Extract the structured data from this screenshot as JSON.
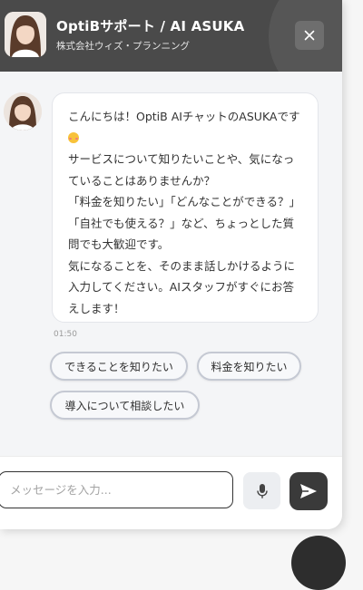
{
  "header": {
    "title": "OptiBサポート / AI ASUKA",
    "subtitle": "株式会社ウィズ・プランニング"
  },
  "message": {
    "text_before_emoji": "こんにちは！OptiB AIチャットのASUKAです",
    "text_after_emoji": "\nサービスについて知りたいことや、気になっていることはありませんか？\n「料金を知りたい」「どんなことができる？」「自社でも使える？」など、ちょっとした質問でも大歓迎です。\n気になることを、そのまま話しかけるように入力してください。AIスタッフがすぐにお答えします！",
    "time": "01:50"
  },
  "quick_replies": [
    "できることを知りたい",
    "料金を知りたい",
    "導入について相談したい"
  ],
  "composer": {
    "placeholder": "メッセージを入力..."
  },
  "icons": {
    "close": "close-icon",
    "mic": "microphone-icon",
    "send": "send-icon"
  },
  "colors": {
    "header_bg": "#4a4a4a",
    "panel_bg": "#f4f5f7",
    "send_button": "#3a3a3a"
  }
}
